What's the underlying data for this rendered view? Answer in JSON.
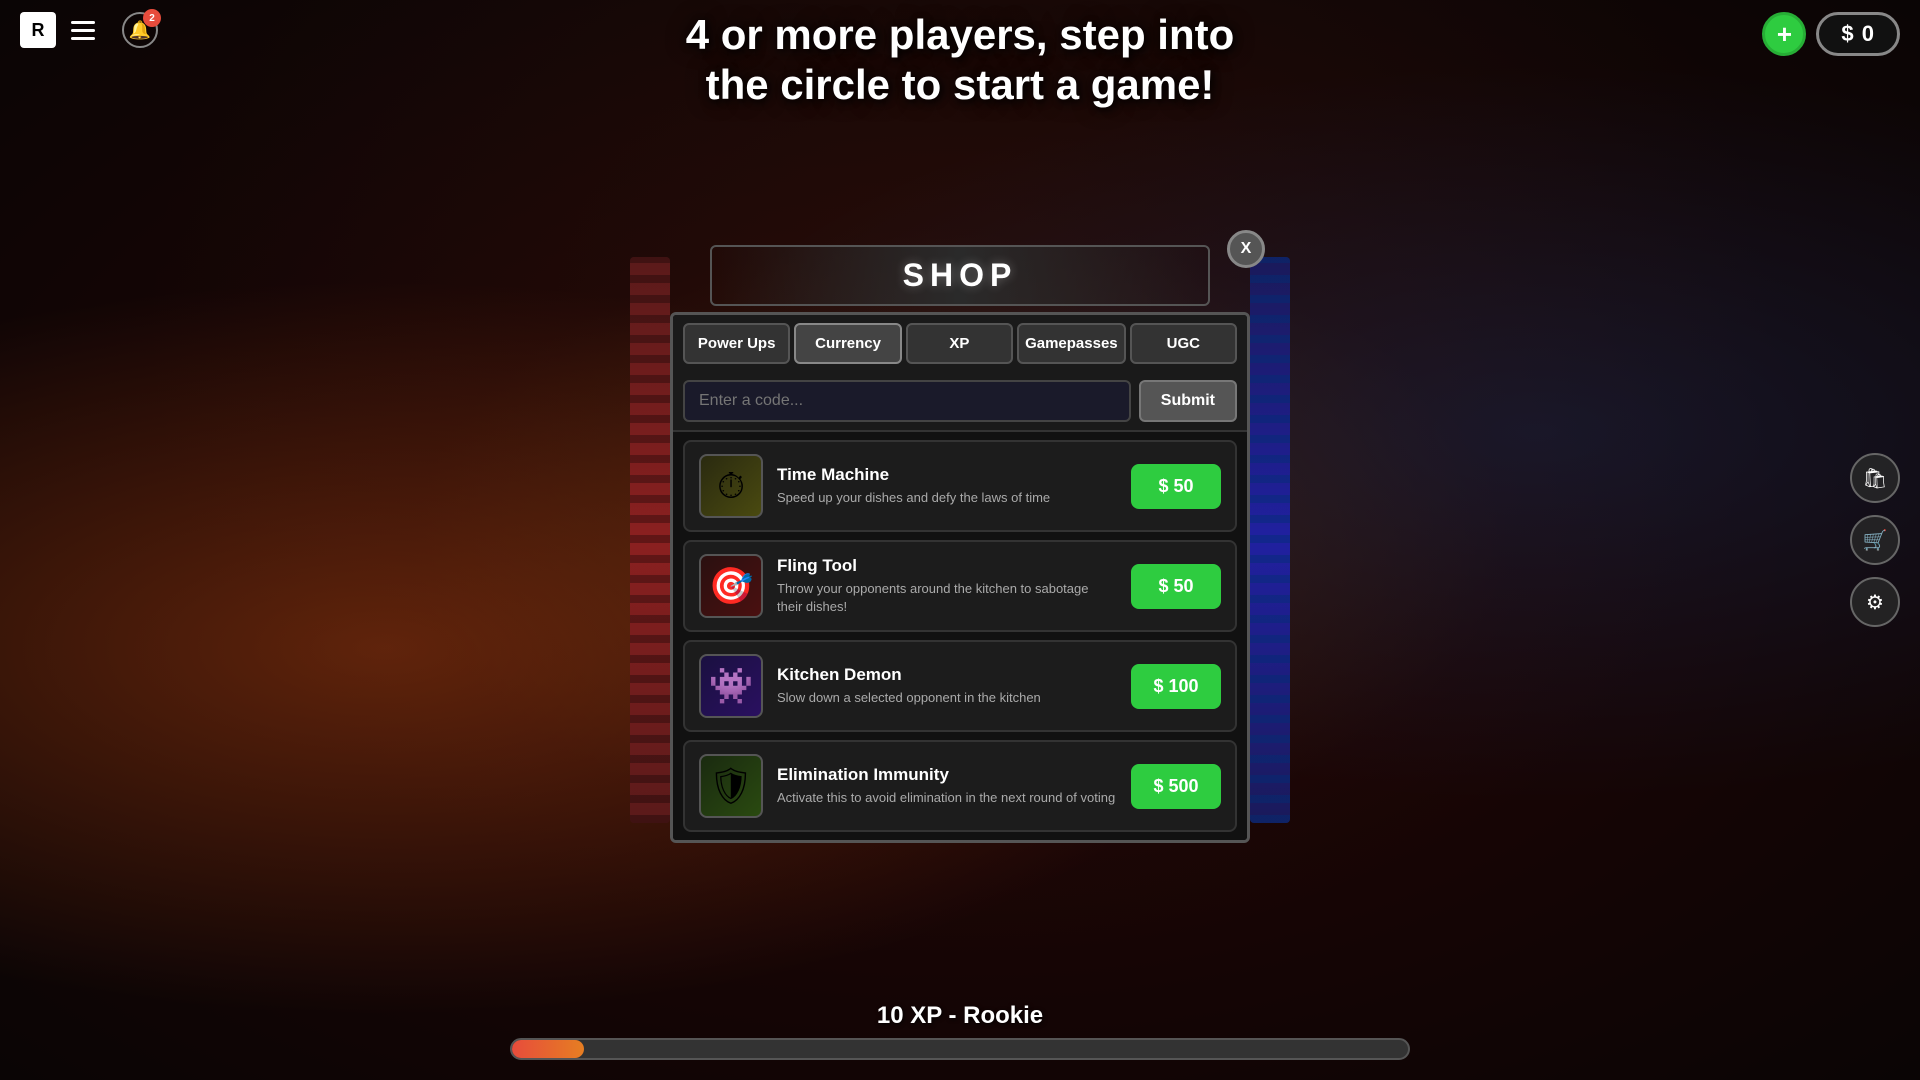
{
  "game": {
    "heading_line1": "4 or more players, step into",
    "heading_line2": "the circle to start a game!"
  },
  "topbar": {
    "roblox_logo": "R",
    "notification_count": "2"
  },
  "currency": {
    "add_icon": "+",
    "amount": "$ 0"
  },
  "shop": {
    "title": "SHOP",
    "close_label": "X",
    "tabs": [
      {
        "label": "Power Ups",
        "id": "power-ups",
        "active": false
      },
      {
        "label": "Currency",
        "id": "currency",
        "active": true
      },
      {
        "label": "XP",
        "id": "xp",
        "active": false
      },
      {
        "label": "Gamepasses",
        "id": "gamepasses",
        "active": false
      },
      {
        "label": "UGC",
        "id": "ugc",
        "active": false
      }
    ],
    "code_input": {
      "placeholder": "Enter a code...",
      "submit_label": "Submit"
    },
    "items": [
      {
        "id": "time-machine",
        "name": "Time Machine",
        "description": "Speed up your dishes and defy the laws of time",
        "price": "$ 50",
        "icon": "⏱",
        "icon_class": "time-machine"
      },
      {
        "id": "fling-tool",
        "name": "Fling Tool",
        "description": "Throw your opponents around the kitchen to sabotage their dishes!",
        "price": "$ 50",
        "icon": "🎯",
        "icon_class": "fling-tool"
      },
      {
        "id": "kitchen-demon",
        "name": "Kitchen Demon",
        "description": "Slow down a selected opponent in the kitchen",
        "price": "$ 100",
        "icon": "👾",
        "icon_class": "kitchen-demon"
      },
      {
        "id": "elimination-immunity",
        "name": "Elimination Immunity",
        "description": "Activate this to avoid elimination in the next round of voting",
        "price": "$ 500",
        "icon": "🛡",
        "icon_class": "elim-immunity"
      }
    ]
  },
  "xp_bar": {
    "label": "10 XP - Rookie",
    "fill_percent": 8
  },
  "right_icons": [
    {
      "id": "shop-icon",
      "symbol": "🛍"
    },
    {
      "id": "cart-icon",
      "symbol": "🛒"
    },
    {
      "id": "settings-icon",
      "symbol": "⚙"
    }
  ]
}
